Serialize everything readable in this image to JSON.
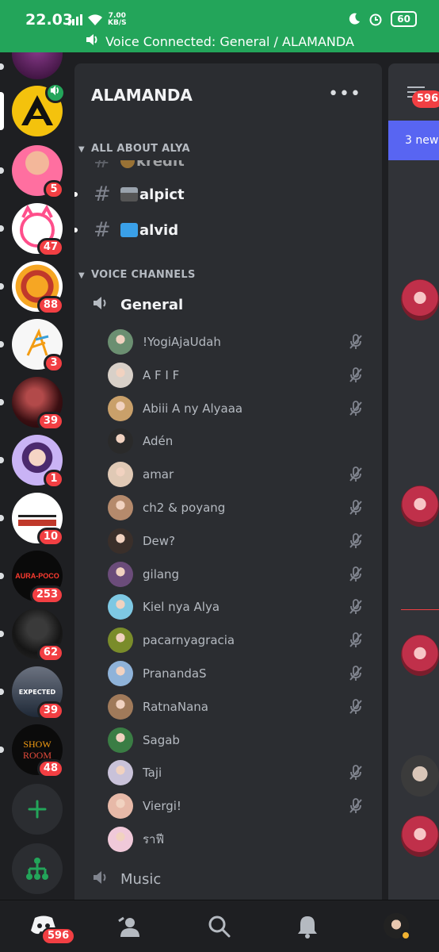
{
  "status": {
    "time": "22.03",
    "speed": "7.00",
    "speed_unit": "KB/S",
    "battery": "60"
  },
  "voice_bar": {
    "text": "Voice Connected: General / ALAMANDA"
  },
  "servers": [
    {
      "badge": ""
    },
    {
      "badge": "5"
    },
    {
      "badge": "47"
    },
    {
      "badge": "88"
    },
    {
      "badge": "3"
    },
    {
      "badge": "39"
    },
    {
      "badge": "1"
    },
    {
      "badge": "10"
    },
    {
      "badge": "253"
    },
    {
      "badge": "62"
    },
    {
      "badge": "39"
    },
    {
      "badge": "48"
    }
  ],
  "server_art": {
    "aura": "AURA-POCO",
    "showroom_1": "SHOW",
    "showroom_2": "ROOM",
    "expected": "EXPECTED"
  },
  "panel": {
    "server_name": "ALAMANDA",
    "category_1": "ALL ABOUT ALYA",
    "channels": [
      {
        "name": "kredit"
      },
      {
        "name": "alpict"
      },
      {
        "name": "alvid"
      }
    ],
    "category_2": "VOICE CHANNELS",
    "voice_channels": [
      {
        "name": "General"
      },
      {
        "name": "Music"
      }
    ],
    "members": [
      {
        "name": "!YogiAjaUdah",
        "muted": true
      },
      {
        "name": "A F I F",
        "muted": true
      },
      {
        "name": "Abiii A ny Alyaaa",
        "muted": true
      },
      {
        "name": "Adén",
        "muted": false
      },
      {
        "name": "amar",
        "muted": true
      },
      {
        "name": "ch2 & poyang",
        "muted": true
      },
      {
        "name": "Dew?",
        "muted": true
      },
      {
        "name": "gilang",
        "muted": true
      },
      {
        "name": "Kiel nya Alya",
        "muted": true
      },
      {
        "name": "pacarnyagracia",
        "muted": true
      },
      {
        "name": "PranandaS",
        "muted": true
      },
      {
        "name": "RatnaNana",
        "muted": true
      },
      {
        "name": "Sagab",
        "muted": false
      },
      {
        "name": "Taji",
        "muted": true
      },
      {
        "name": "Viergi!",
        "muted": true
      },
      {
        "name": "ราฟี",
        "muted": false
      }
    ]
  },
  "chat": {
    "badge": "596",
    "new_messages": "3 new"
  },
  "bottom_nav": {
    "home_badge": "596"
  },
  "colors": {
    "accent": "#23a55a",
    "badge": "#f23f43",
    "blurple": "#5865f2"
  }
}
